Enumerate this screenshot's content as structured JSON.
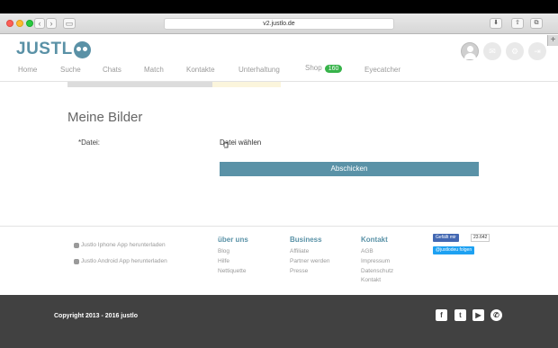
{
  "browser": {
    "url": "v2.justlo.de"
  },
  "site": {
    "logo": "JUSTL"
  },
  "nav": {
    "items": [
      "Home",
      "Suche",
      "Chats",
      "Match",
      "Kontakte",
      "Unterhaltung",
      "Shop",
      "Eyecatcher"
    ],
    "shop_badge": "160"
  },
  "main": {
    "title": "Meine Bilder",
    "file_label": "*Datei:",
    "file_button": "Datei wählen",
    "submit": "Abschicken"
  },
  "footer": {
    "apps": [
      "Justlo Iphone App herunterladen",
      "Justlo Android App herunterladen"
    ],
    "columns": [
      {
        "title": "über uns",
        "links": [
          "Blog",
          "Hilfe",
          "Nettiquette"
        ]
      },
      {
        "title": "Business",
        "links": [
          "Affiliate",
          "Partner werden",
          "Presse"
        ]
      },
      {
        "title": "Kontakt",
        "links": [
          "AGB",
          "Impressum",
          "Datenschutz",
          "Kontakt"
        ]
      }
    ],
    "facebook_like": "Gefällt mir",
    "facebook_count": "23.642",
    "twitter_follow": "@justlodeu folgen",
    "copyright": "Copyright 2013 - 2016 justlo"
  },
  "colors": {
    "brand": "#5a92a7",
    "badge": "#37b34a",
    "footer_bg": "#414141"
  },
  "icons": [
    "apple-icon",
    "android-icon",
    "facebook-icon",
    "twitter-icon",
    "youtube-icon",
    "whatsapp-icon"
  ]
}
